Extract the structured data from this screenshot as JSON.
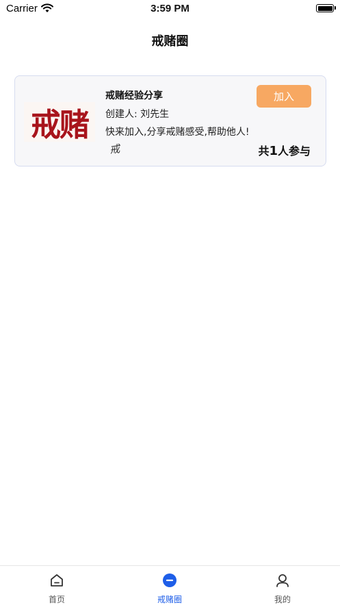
{
  "status_bar": {
    "carrier": "Carrier",
    "time": "3:59 PM"
  },
  "nav": {
    "title": "戒赌圈"
  },
  "group": {
    "logo_text": "戒赌",
    "name": "戒赌经验分享",
    "creator_label": "创建人:",
    "creator_name": "刘先生",
    "description": "快来加入,分享戒赌感受,帮助他人!",
    "join_label": "加入",
    "member_avatar_text": "戒",
    "member_prefix": "共",
    "member_count": "1",
    "member_suffix": "人参与"
  },
  "tabs": [
    {
      "label": "首页",
      "icon": "home-icon",
      "active": false
    },
    {
      "label": "戒赌圈",
      "icon": "minus-circle-icon",
      "active": true
    },
    {
      "label": "我的",
      "icon": "user-icon",
      "active": false
    }
  ],
  "colors": {
    "accent": "#1e5ee8",
    "join_button": "#f7a862",
    "logo_red": "#a8141c"
  }
}
